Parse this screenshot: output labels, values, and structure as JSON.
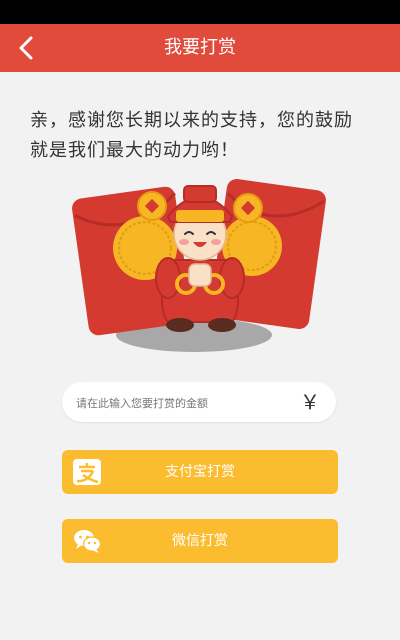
{
  "header": {
    "title": "我要打赏"
  },
  "message": {
    "text": "亲，感谢您长期以来的支持，您的鼓励就是我们最大的动力哟！"
  },
  "amount": {
    "placeholder": "请在此输入您要打赏的金额",
    "value": "",
    "currency_symbol": "￥"
  },
  "buttons": {
    "alipay_label": "支付宝打赏",
    "wechat_label": "微信打赏"
  },
  "colors": {
    "header": "#e04b3c",
    "button": "#fbbd2f",
    "background": "#f2f2f2"
  },
  "icons": {
    "back": "chevron-left-icon",
    "alipay": "alipay-icon",
    "wechat": "wechat-icon"
  }
}
